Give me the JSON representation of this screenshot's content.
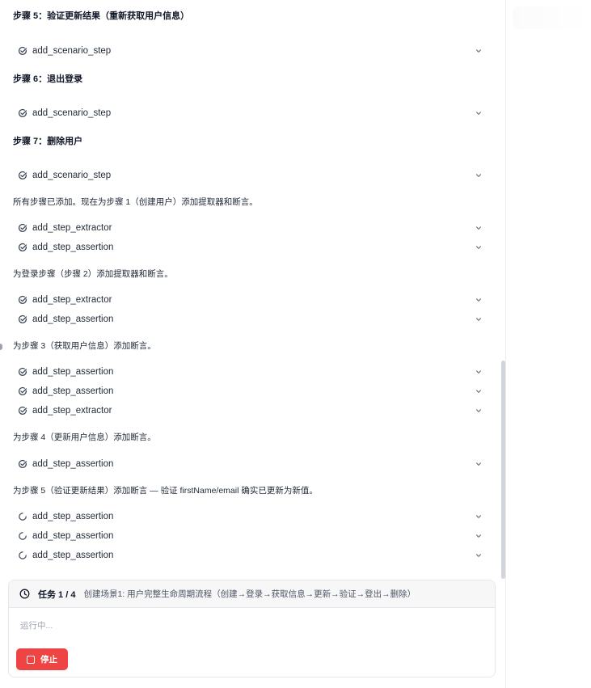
{
  "chat": {
    "steps": {
      "step5_heading": "步骤 5：验证更新结果（重新获取用户信息）",
      "step6_heading": "步骤 6：退出登录",
      "step7_heading": "步骤 7：删除用户"
    },
    "notes": {
      "all_added": "所有步骤已添加。现在为步骤 1（创建用户）添加提取器和断言。",
      "login_step": "为登录步骤（步骤 2）添加提取器和断言。",
      "step3": "为步骤 3（获取用户信息）添加断言。",
      "step4": "为步骤 4（更新用户信息）添加断言。",
      "step5": "为步骤 5（验证更新结果）添加断言 — 验证 firstName/email 确实已更新为新值。"
    },
    "tool_calls": [
      {
        "name": "add_scenario_step",
        "status": "done"
      },
      {
        "name": "add_scenario_step",
        "status": "done"
      },
      {
        "name": "add_scenario_step",
        "status": "done"
      },
      {
        "name": "add_step_extractor",
        "status": "done"
      },
      {
        "name": "add_step_assertion",
        "status": "done"
      },
      {
        "name": "add_step_extractor",
        "status": "done"
      },
      {
        "name": "add_step_assertion",
        "status": "done"
      },
      {
        "name": "add_step_assertion",
        "status": "done"
      },
      {
        "name": "add_step_assertion",
        "status": "done"
      },
      {
        "name": "add_step_extractor",
        "status": "done"
      },
      {
        "name": "add_step_assertion",
        "status": "done"
      },
      {
        "name": "add_step_assertion",
        "status": "running"
      },
      {
        "name": "add_step_assertion",
        "status": "running"
      },
      {
        "name": "add_step_assertion",
        "status": "running"
      }
    ]
  },
  "task": {
    "label": "任务 1 / 4",
    "description": "创建场景1: 用户完整生命周期流程（创建→登录→获取信息→更新→验证→登出→删除）",
    "status_text": "运行中...",
    "stop_label": "停止"
  },
  "colors": {
    "stop_button": "#ef4444",
    "done_icon": "#374151",
    "running_icon": "#4b5563"
  }
}
